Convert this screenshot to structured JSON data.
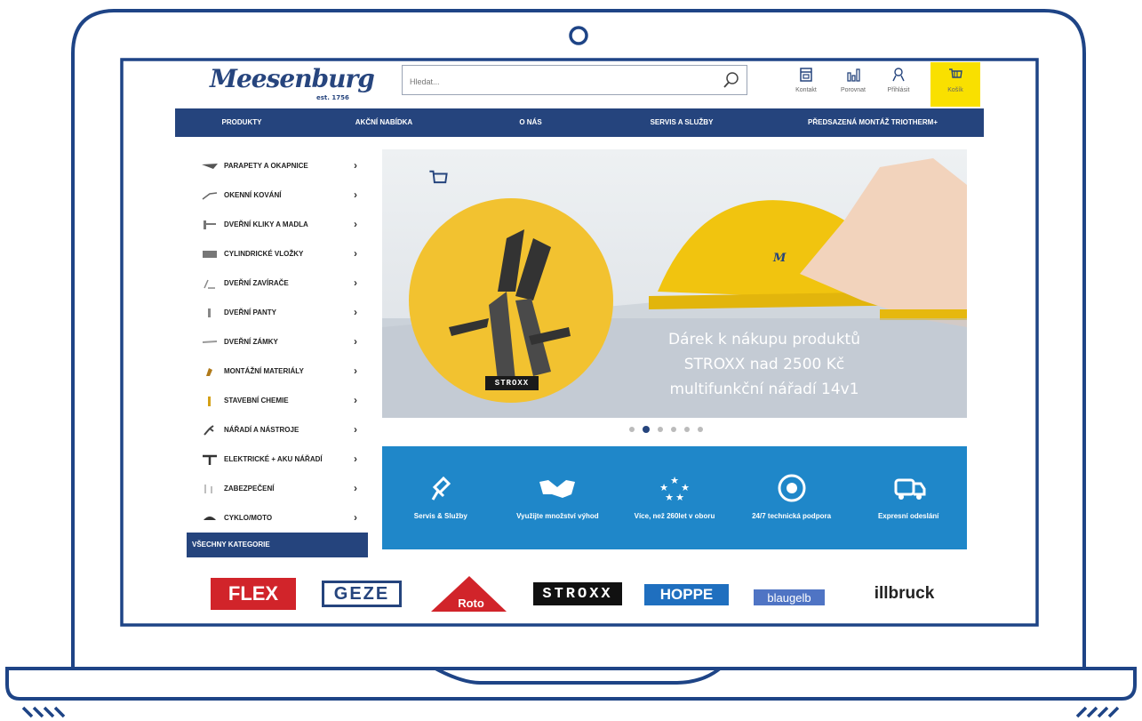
{
  "header": {
    "search_placeholder": "Hledat...",
    "icons": {
      "contact": "Kontakt",
      "compare": "Porovnat",
      "login": "Přihlásit",
      "cart": "Košík"
    }
  },
  "logo": {
    "text": "Meesenburg",
    "est": "est. 1756"
  },
  "nav": [
    "PRODUKTY",
    "AKČNÍ NABÍDKA",
    "O NÁS",
    "SERVIS A SLUŽBY",
    "PŘEDSAZENÁ MONTÁŽ TRIOTHERM+"
  ],
  "sidebar": {
    "items": [
      "PARAPETY A OKAPNICE",
      "OKENNÍ KOVÁNÍ",
      "DVEŘNÍ KLIKY A MADLA",
      "CYLINDRICKÉ VLOŽKY",
      "DVEŘNÍ ZAVÍRAČE",
      "DVEŘNÍ PANTY",
      "DVEŘNÍ ZÁMKY",
      "MONTÁŽNÍ MATERIÁLY",
      "STAVEBNÍ CHEMIE",
      "NÁŘADÍ A NÁSTROJE",
      "ELEKTRICKÉ + AKU NÁŘADÍ",
      "ZABEZPEČENÍ",
      "CYKLO/MOTO"
    ],
    "all_categories": "VŠECHNY KATEGORIE"
  },
  "hero": {
    "line1": "Dárek k nákupu produktů",
    "line2": "STROXX nad 2500 Kč",
    "line3": "multifunkční nářadí 14v1",
    "badge": "STROXX",
    "helmet_logo": "M"
  },
  "carousel": {
    "count": 6,
    "active": 1
  },
  "features": [
    {
      "label": "Servis & Služby"
    },
    {
      "label": "Využijte množství výhod"
    },
    {
      "label": "Více, než 260let v oboru"
    },
    {
      "label": "24/7 technická podpora"
    },
    {
      "label": "Expresní odeslání"
    }
  ],
  "brands": [
    "FLEX",
    "GEZE",
    "Roto",
    "STROXX",
    "HOPPE",
    "blaugelb",
    "illbruck"
  ],
  "colors": {
    "brand_blue": "#25447d",
    "feature_blue": "#1f87c9",
    "cart_yellow": "#f9e000",
    "frame_blue": "#1e4486",
    "flex_red": "#d1242a"
  }
}
